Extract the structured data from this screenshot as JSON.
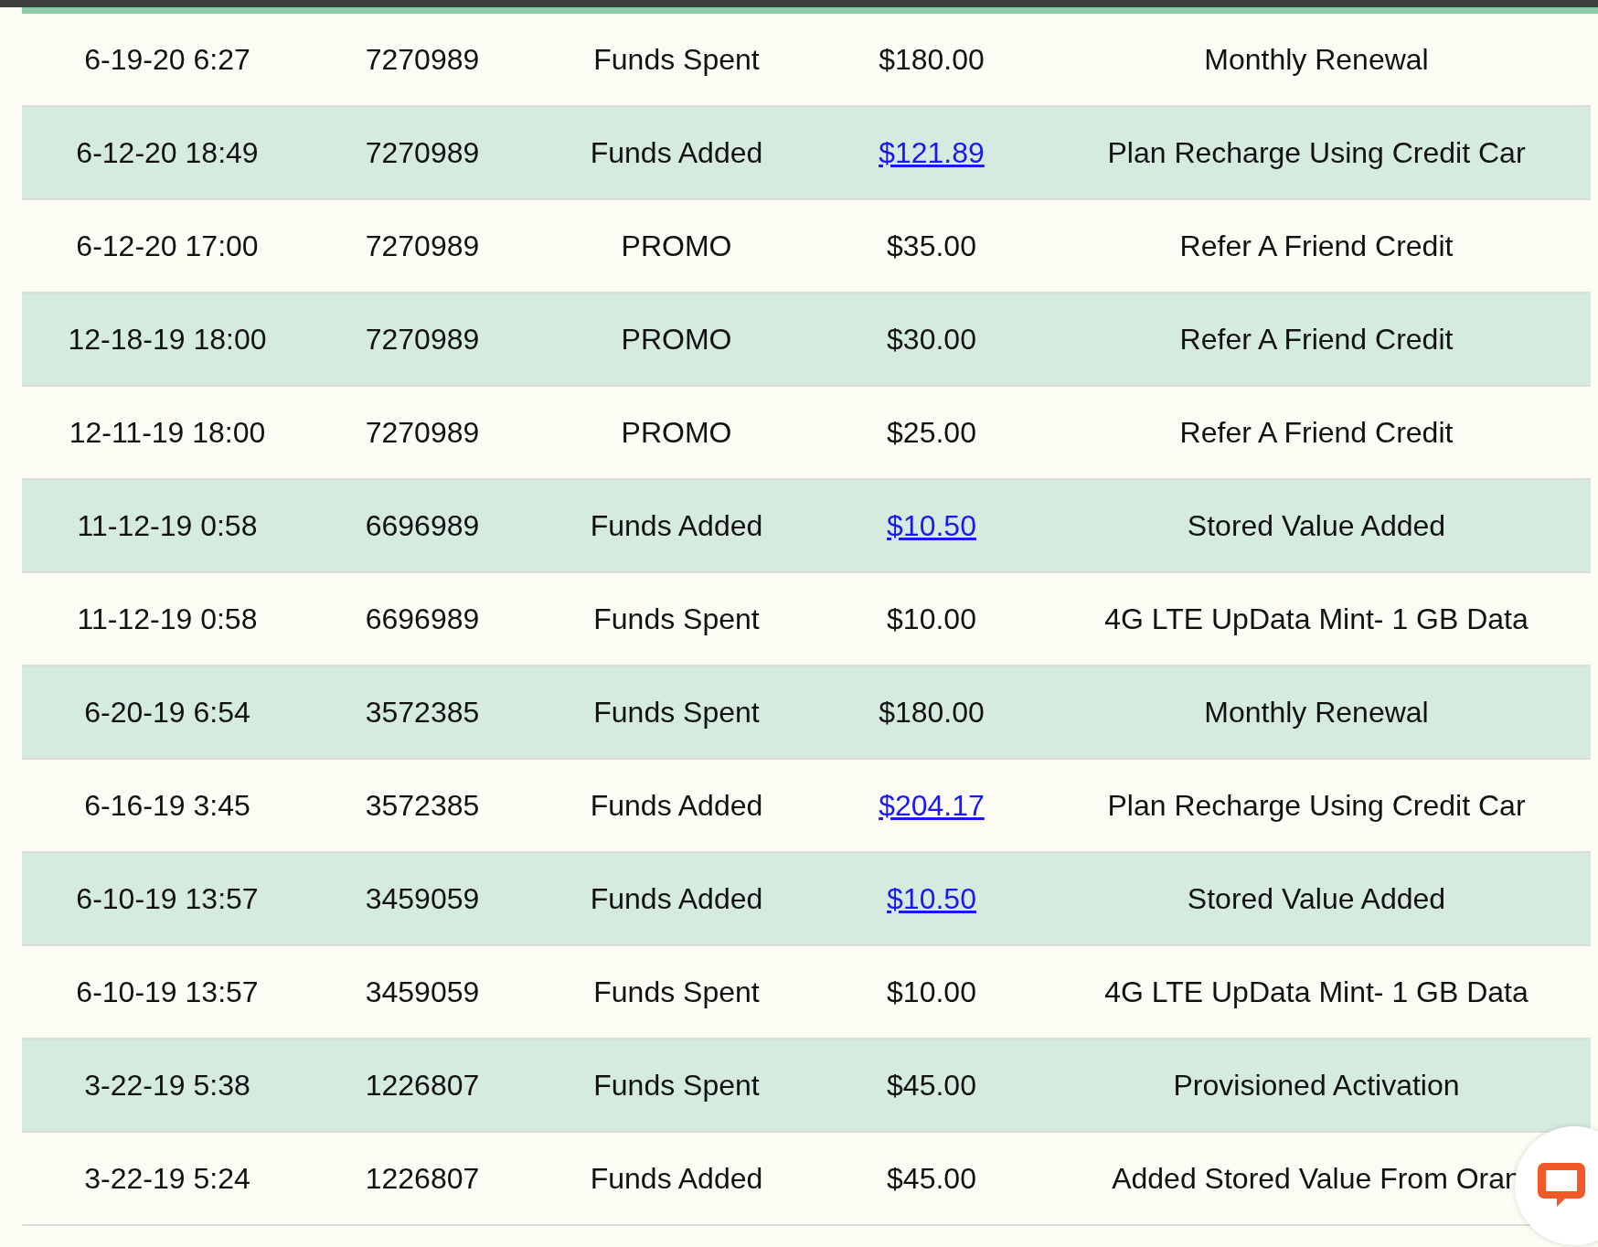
{
  "table": {
    "rows": [
      {
        "date": "6-19-20 6:27",
        "account": "7270989",
        "type": "Funds Spent",
        "amount": "$180.00",
        "amount_link": false,
        "description": "Monthly Renewal"
      },
      {
        "date": "6-12-20 18:49",
        "account": "7270989",
        "type": "Funds Added",
        "amount": "$121.89",
        "amount_link": true,
        "description": "Plan Recharge Using Credit Car"
      },
      {
        "date": "6-12-20 17:00",
        "account": "7270989",
        "type": "PROMO",
        "amount": "$35.00",
        "amount_link": false,
        "description": "Refer A Friend Credit"
      },
      {
        "date": "12-18-19 18:00",
        "account": "7270989",
        "type": "PROMO",
        "amount": "$30.00",
        "amount_link": false,
        "description": "Refer A Friend Credit"
      },
      {
        "date": "12-11-19 18:00",
        "account": "7270989",
        "type": "PROMO",
        "amount": "$25.00",
        "amount_link": false,
        "description": "Refer A Friend Credit"
      },
      {
        "date": "11-12-19 0:58",
        "account": "6696989",
        "type": "Funds Added",
        "amount": "$10.50",
        "amount_link": true,
        "description": "Stored Value Added"
      },
      {
        "date": "11-12-19 0:58",
        "account": "6696989",
        "type": "Funds Spent",
        "amount": "$10.00",
        "amount_link": false,
        "description": "4G LTE UpData Mint- 1 GB Data"
      },
      {
        "date": "6-20-19 6:54",
        "account": "3572385",
        "type": "Funds Spent",
        "amount": "$180.00",
        "amount_link": false,
        "description": "Monthly Renewal"
      },
      {
        "date": "6-16-19 3:45",
        "account": "3572385",
        "type": "Funds Added",
        "amount": "$204.17",
        "amount_link": true,
        "description": "Plan Recharge Using Credit Car"
      },
      {
        "date": "6-10-19 13:57",
        "account": "3459059",
        "type": "Funds Added",
        "amount": "$10.50",
        "amount_link": true,
        "description": "Stored Value Added"
      },
      {
        "date": "6-10-19 13:57",
        "account": "3459059",
        "type": "Funds Spent",
        "amount": "$10.00",
        "amount_link": false,
        "description": "4G LTE UpData Mint- 1 GB Data"
      },
      {
        "date": "3-22-19 5:38",
        "account": "1226807",
        "type": "Funds Spent",
        "amount": "$45.00",
        "amount_link": false,
        "description": "Provisioned Activation"
      },
      {
        "date": "3-22-19 5:24",
        "account": "1226807",
        "type": "Funds Added",
        "amount": "$45.00",
        "amount_link": false,
        "description": "Added Stored Value From Oran"
      }
    ]
  }
}
